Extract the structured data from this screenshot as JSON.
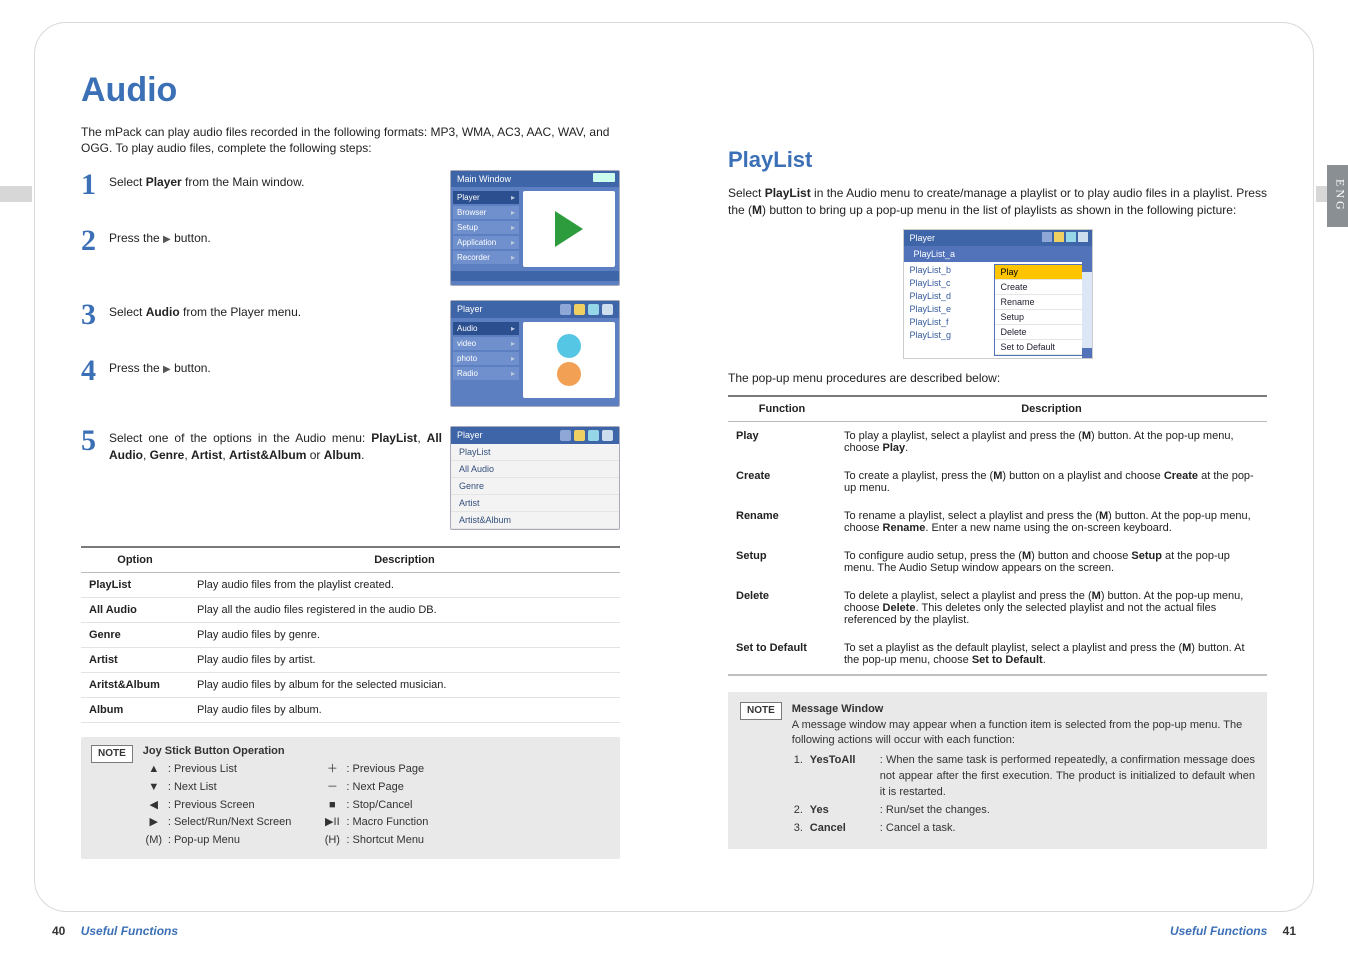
{
  "lang_tab": "ENG",
  "left": {
    "title": "Audio",
    "intro": "The mPack can play audio files recorded in the following formats: MP3, WMA, AC3, AAC, WAV, and OGG. To play audio files, complete the following steps:",
    "steps": [
      {
        "num": "1",
        "text": "Select Player from the Main window.",
        "bold_words": [
          "Player"
        ]
      },
      {
        "num": "2",
        "text": "Press the ▶ button."
      },
      {
        "num": "3",
        "text": "Select Audio from the Player menu.",
        "bold_words": [
          "Audio"
        ]
      },
      {
        "num": "4",
        "text": "Press the ▶ button."
      },
      {
        "num": "5",
        "text": "Select one of the options in the Audio menu: PlayList, All Audio, Genre, Artist, Artist&Album or Album.",
        "bold_words": [
          "PlayList",
          "All Audio",
          "Genre",
          "Artist",
          "Artist&Album",
          "Album"
        ]
      }
    ],
    "shot1": {
      "title": "Main Window",
      "menu": [
        "Player",
        "Browser",
        "Setup",
        "Application",
        "Recorder"
      ]
    },
    "shot2": {
      "title": "Player",
      "menu": [
        "Audio",
        "video",
        "photo",
        "Radio"
      ]
    },
    "shot3": {
      "title": "Player",
      "list": [
        "PlayList",
        "All Audio",
        "Genre",
        "Artist",
        "Artist&Album"
      ]
    },
    "options_table": {
      "headers": [
        "Option",
        "Description"
      ],
      "rows": [
        [
          "PlayList",
          "Play audio files from the playlist created."
        ],
        [
          "All Audio",
          "Play all the audio files registered in the audio DB."
        ],
        [
          "Genre",
          "Play audio files by genre."
        ],
        [
          "Artist",
          "Play audio files by artist."
        ],
        [
          "Aritst&Album",
          "Play audio files by album for the selected musician."
        ],
        [
          "Album",
          "Play audio files by album."
        ]
      ]
    },
    "note": {
      "tag": "NOTE",
      "heading": "Joy Stick Button Operation",
      "left_col": [
        [
          "▲",
          ": Previous List"
        ],
        [
          "▼",
          ": Next List"
        ],
        [
          "◀",
          ": Previous Screen"
        ],
        [
          "▶",
          ": Select/Run/Next Screen"
        ],
        [
          "(M)",
          ": Pop-up Menu"
        ]
      ],
      "right_col": [
        [
          "＋",
          ": Previous Page"
        ],
        [
          "－",
          ": Next Page"
        ],
        [
          "■",
          ": Stop/Cancel"
        ],
        [
          "▶II",
          ": Macro Function"
        ],
        [
          "(H)",
          ": Shortcut Menu"
        ]
      ]
    },
    "footer": {
      "page": "40",
      "section": "Useful Functions"
    }
  },
  "right": {
    "title": "PlayList",
    "intro": "Select PlayList in the Audio menu to create/manage a playlist or to play audio files in a playlist. Press the (M) button to bring up a pop-up menu in the list of playlists as shown in the following picture:",
    "bold_words_intro": [
      "PlayList",
      "M"
    ],
    "shot": {
      "title": "Player",
      "header": "PlayList_a",
      "list": [
        "PlayList_b",
        "PlayList_c",
        "PlayList_d",
        "PlayList_e",
        "PlayList_f",
        "PlayList_g"
      ],
      "popup": [
        "Play",
        "Create",
        "Rename",
        "Setup",
        "Delete",
        "Set to Default"
      ]
    },
    "popup_desc": "The pop-up menu procedures are described below:",
    "func_table": {
      "headers": [
        "Function",
        "Description"
      ],
      "rows": [
        [
          "Play",
          "To play a playlist, select a playlist and press the (M) button. At the pop-up menu, choose Play."
        ],
        [
          "Create",
          "To create a playlist, press the (M) button on a playlist and choose Create at the pop-up menu."
        ],
        [
          "Rename",
          "To rename a playlist, select a playlist and press the (M) button. At the pop-up menu, choose Rename. Enter a new name using the on-screen keyboard."
        ],
        [
          "Setup",
          "To configure audio setup, press the (M) button and choose Setup at the pop-up menu. The Audio Setup window appears on the screen."
        ],
        [
          "Delete",
          "To delete a playlist, select a playlist and press the (M) button. At the pop-up menu, choose Delete. This deletes only the selected playlist and not the actual files referenced by the playlist."
        ],
        [
          "Set to Default",
          "To set a playlist as the default playlist, select a playlist and press the (M) button. At the pop-up menu, choose Set to Default."
        ]
      ]
    },
    "msg_note": {
      "tag": "NOTE",
      "heading": "Message Window",
      "intro": "A message window may appear when a function item is selected from the pop-up menu. The following actions will occur with each function:",
      "items": [
        [
          "1.",
          "YesToAll",
          ": When the same task is performed repeatedly, a confirmation message does not appear after the first execution. The product is initialized to default when it is restarted."
        ],
        [
          "2.",
          "Yes",
          ": Run/set the changes."
        ],
        [
          "3.",
          "Cancel",
          ": Cancel a task."
        ]
      ]
    },
    "footer": {
      "page": "41",
      "section": "Useful Functions"
    }
  }
}
